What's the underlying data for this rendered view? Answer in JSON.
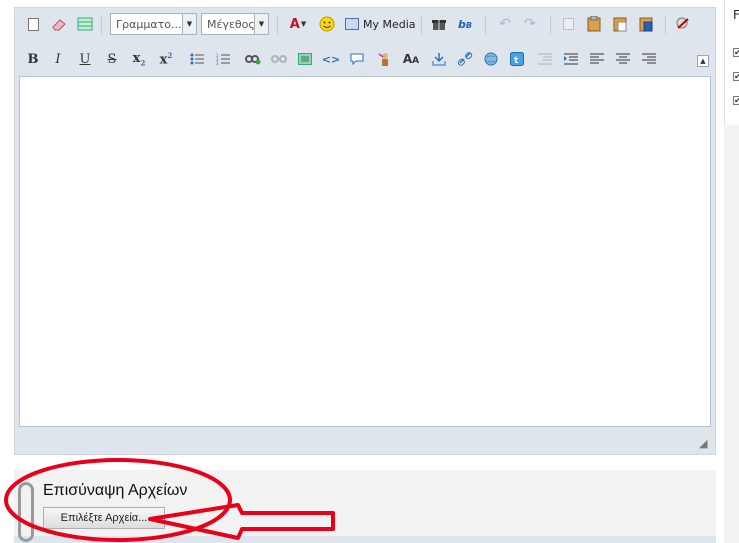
{
  "toolbar": {
    "font_combo": "Γραμματο...",
    "size_combo": "Μέγεθος",
    "my_media": "My Media"
  },
  "attachments": {
    "title": "Επισύναψη Αρχείων",
    "choose_button": "Επιλέξτε Αρχεία..."
  },
  "right_panel": {
    "title_fragment": "F"
  },
  "annotation_color": "#e8001a"
}
